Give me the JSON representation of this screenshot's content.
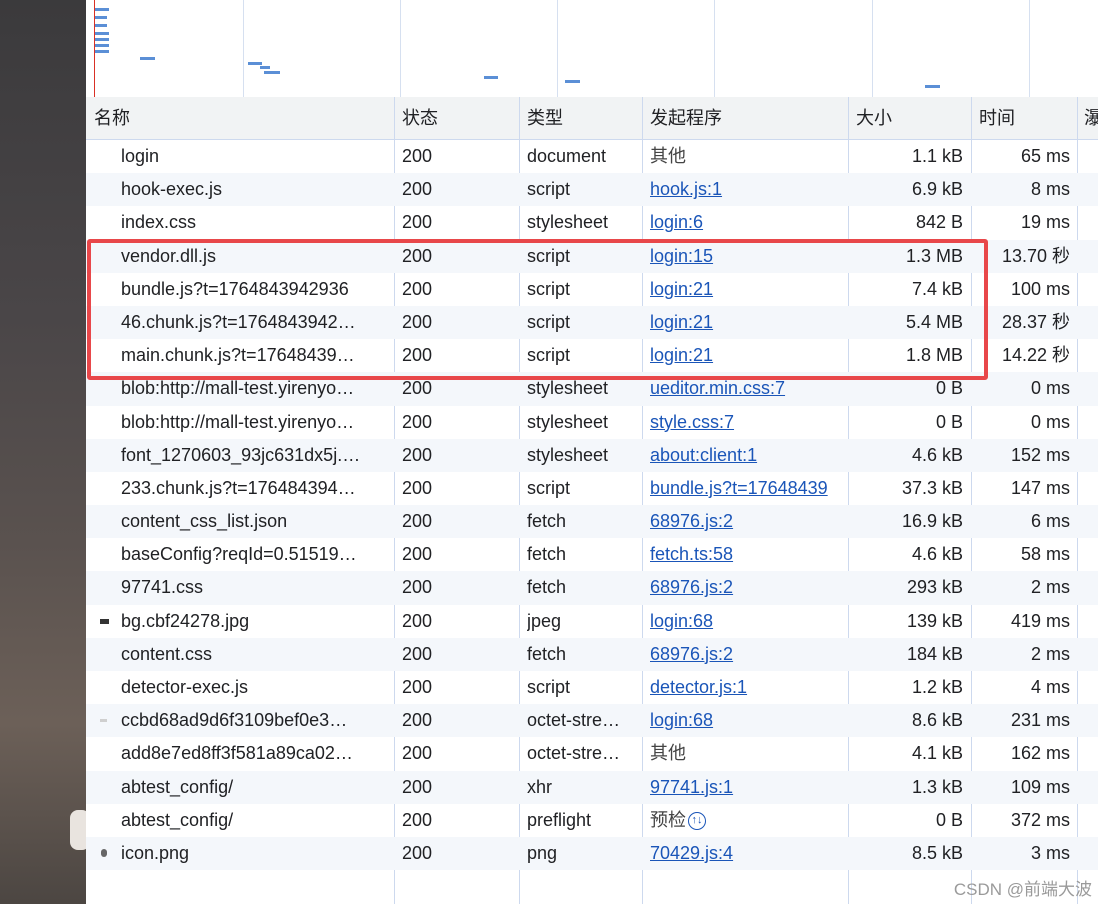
{
  "columns": {
    "name": "名称",
    "status": "状态",
    "type": "类型",
    "initiator": "发起程序",
    "size": "大小",
    "time": "时间",
    "edge": "瀑"
  },
  "rows": [
    {
      "name": "login",
      "status": "200",
      "type": "document",
      "initiator": "其他",
      "initiator_link": false,
      "size": "1.1 kB",
      "time": "65 ms",
      "icon": ""
    },
    {
      "name": "hook-exec.js",
      "status": "200",
      "type": "script",
      "initiator": "hook.js:1",
      "initiator_link": true,
      "size": "6.9 kB",
      "time": "8 ms",
      "icon": ""
    },
    {
      "name": "index.css",
      "status": "200",
      "type": "stylesheet",
      "initiator": "login:6",
      "initiator_link": true,
      "size": "842 B",
      "time": "19 ms",
      "icon": ""
    },
    {
      "name": "vendor.dll.js",
      "status": "200",
      "type": "script",
      "initiator": "login:15",
      "initiator_link": true,
      "size": "1.3 MB",
      "time": "13.70 秒",
      "icon": ""
    },
    {
      "name": "bundle.js?t=1764843942936",
      "status": "200",
      "type": "script",
      "initiator": "login:21",
      "initiator_link": true,
      "size": "7.4 kB",
      "time": "100 ms",
      "icon": ""
    },
    {
      "name": "46.chunk.js?t=1764843942…",
      "status": "200",
      "type": "script",
      "initiator": "login:21",
      "initiator_link": true,
      "size": "5.4 MB",
      "time": "28.37 秒",
      "icon": ""
    },
    {
      "name": "main.chunk.js?t=17648439…",
      "status": "200",
      "type": "script",
      "initiator": "login:21",
      "initiator_link": true,
      "size": "1.8 MB",
      "time": "14.22 秒",
      "icon": ""
    },
    {
      "name": "blob:http://mall-test.yirenyo…",
      "status": "200",
      "type": "stylesheet",
      "initiator": "ueditor.min.css:7",
      "initiator_link": true,
      "size": "0 B",
      "time": "0 ms",
      "icon": ""
    },
    {
      "name": "blob:http://mall-test.yirenyo…",
      "status": "200",
      "type": "stylesheet",
      "initiator": "style.css:7",
      "initiator_link": true,
      "size": "0 B",
      "time": "0 ms",
      "icon": ""
    },
    {
      "name": "font_1270603_93jc631dx5j.…",
      "status": "200",
      "type": "stylesheet",
      "initiator": "about:client:1",
      "initiator_link": true,
      "size": "4.6 kB",
      "time": "152 ms",
      "icon": ""
    },
    {
      "name": "233.chunk.js?t=176484394…",
      "status": "200",
      "type": "script",
      "initiator": "bundle.js?t=17648439",
      "initiator_link": true,
      "size": "37.3 kB",
      "time": "147 ms",
      "icon": ""
    },
    {
      "name": "content_css_list.json",
      "status": "200",
      "type": "fetch",
      "initiator": "68976.js:2",
      "initiator_link": true,
      "size": "16.9 kB",
      "time": "6 ms",
      "icon": ""
    },
    {
      "name": "baseConfig?reqId=0.51519…",
      "status": "200",
      "type": "fetch",
      "initiator": "fetch.ts:58",
      "initiator_link": true,
      "size": "4.6 kB",
      "time": "58 ms",
      "icon": ""
    },
    {
      "name": "97741.css",
      "status": "200",
      "type": "fetch",
      "initiator": "68976.js:2",
      "initiator_link": true,
      "size": "293 kB",
      "time": "2 ms",
      "icon": ""
    },
    {
      "name": "bg.cbf24278.jpg",
      "status": "200",
      "type": "jpeg",
      "initiator": "login:68",
      "initiator_link": true,
      "size": "139 kB",
      "time": "419 ms",
      "icon": "image"
    },
    {
      "name": "content.css",
      "status": "200",
      "type": "fetch",
      "initiator": "68976.js:2",
      "initiator_link": true,
      "size": "184 kB",
      "time": "2 ms",
      "icon": ""
    },
    {
      "name": "detector-exec.js",
      "status": "200",
      "type": "script",
      "initiator": "detector.js:1",
      "initiator_link": true,
      "size": "1.2 kB",
      "time": "4 ms",
      "icon": ""
    },
    {
      "name": "ccbd68ad9d6f3109bef0e3…",
      "status": "200",
      "type": "octet-stre…",
      "initiator": "login:68",
      "initiator_link": true,
      "size": "8.6 kB",
      "time": "231 ms",
      "icon": "light"
    },
    {
      "name": "add8e7ed8ff3f581a89ca02…",
      "status": "200",
      "type": "octet-stre…",
      "initiator": "其他",
      "initiator_link": false,
      "size": "4.1 kB",
      "time": "162 ms",
      "icon": ""
    },
    {
      "name": "abtest_config/",
      "status": "200",
      "type": "xhr",
      "initiator": "97741.js:1",
      "initiator_link": true,
      "size": "1.3 kB",
      "time": "109 ms",
      "icon": ""
    },
    {
      "name": "abtest_config/",
      "status": "200",
      "type": "preflight",
      "initiator": "预检",
      "initiator_link": false,
      "initiator_icon": "↑↓",
      "size": "0 B",
      "time": "372 ms",
      "icon": ""
    },
    {
      "name": "icon.png",
      "status": "200",
      "type": "png",
      "initiator": "70429.js:4",
      "initiator_link": true,
      "size": "8.5 kB",
      "time": "3 ms",
      "icon": "round"
    }
  ],
  "watermark": "CSDN @前端大波"
}
